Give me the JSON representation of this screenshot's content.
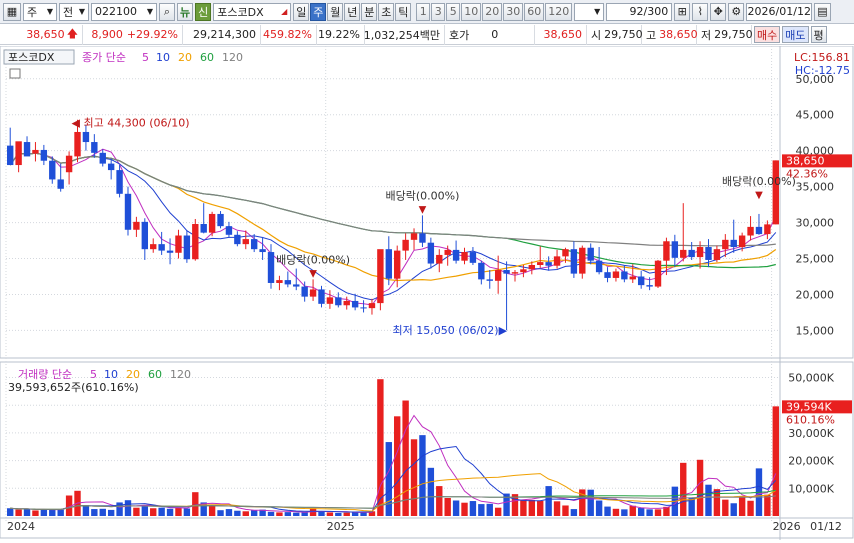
{
  "toolbar": {
    "period_type": "주",
    "scope": "전",
    "code": "022100",
    "news_badge": "뉴",
    "credit_badge": "신",
    "stock_name": "포스코DX",
    "periods": [
      "일",
      "주",
      "월",
      "년",
      "분",
      "초",
      "틱"
    ],
    "active_period": "주",
    "minute_options": [
      "1",
      "3",
      "5",
      "10",
      "20",
      "30",
      "60",
      "120"
    ],
    "bar_count": "92",
    "bar_total": "/300",
    "date": "2026/01/12"
  },
  "quote": {
    "price": "38,650",
    "change": "8,900",
    "change_pct": "+29.92%",
    "volume": "29,214,300",
    "volume_ratio": "459.82%",
    "turnover": "19.22%",
    "amount": "1,032,254백만",
    "hoga_label": "호가",
    "hoga_value": "0",
    "hoga_price": "38,650",
    "open_label": "시",
    "open": "29,750",
    "high_label": "고",
    "high": "38,650",
    "low_label": "저",
    "low": "29,750",
    "buy_label": "매수",
    "sell_label": "매도",
    "eval_label": "평"
  },
  "chart_data": {
    "type": "candlestick",
    "title": "포스코DX",
    "legend": {
      "price_label": "종가 단순",
      "ma_periods": [
        "5",
        "10",
        "20",
        "60",
        "120"
      ],
      "ma_colors": [
        "#c02fc0",
        "#2040d0",
        "#f0a000",
        "#20a040",
        "#808080"
      ],
      "volume_label": "거래량 단순",
      "volume_value": "39,593,652주(610.16%)"
    },
    "corner": {
      "lc": "LC:156.81",
      "hc": "HC:-12.75"
    },
    "price_axis": {
      "ticks": [
        "50,000",
        "45,000",
        "40,000",
        "35,000",
        "30,000",
        "25,000",
        "20,000",
        "15,000"
      ],
      "values": [
        50000,
        45000,
        40000,
        35000,
        30000,
        25000,
        20000,
        15000
      ],
      "ylim": [
        12000,
        54000
      ]
    },
    "volume_axis": {
      "ticks": [
        "50,000K",
        "40,000K",
        "30,000K",
        "20,000K",
        "10,000K"
      ],
      "values": [
        50000,
        40000,
        30000,
        20000,
        10000
      ],
      "ylim": [
        0,
        52000
      ]
    },
    "last_price_tag": {
      "price": "38,650",
      "pct": "42.36%"
    },
    "last_volume_tag": {
      "volume": "39,594K",
      "pct": "610.16%"
    },
    "x_labels": [
      {
        "label": "2024",
        "index": 0
      },
      {
        "label": "2025",
        "index": 38
      },
      {
        "label": "2026",
        "index": 91
      }
    ],
    "x_end_label": "01/12",
    "annotations": [
      {
        "text": "최고 44,300 (06/10)",
        "type": "high",
        "index": 8,
        "price": 44300
      },
      {
        "text": "최저 15,050 (06/02)",
        "type": "low",
        "index": 59,
        "price": 15050
      },
      {
        "text": "배당락(0.00%)",
        "type": "div",
        "index": 36,
        "price": 22100
      },
      {
        "text": "배당락(0.00%)",
        "type": "div",
        "index": 49,
        "price": 31000
      },
      {
        "text": "배당락(0.00%)",
        "type": "div",
        "index": 89,
        "price": 33000
      }
    ],
    "candles": [
      [
        40700,
        43200,
        38500,
        38000
      ],
      [
        38000,
        39800,
        37000,
        41300
      ],
      [
        41200,
        42000,
        39800,
        39200
      ],
      [
        39600,
        41200,
        38500,
        40100
      ],
      [
        40100,
        40800,
        38000,
        38600
      ],
      [
        38600,
        39200,
        35400,
        36000
      ],
      [
        36000,
        38200,
        34300,
        34700
      ],
      [
        37000,
        39900,
        35300,
        39300
      ],
      [
        39200,
        44300,
        38400,
        42600
      ],
      [
        42600,
        43600,
        40000,
        41200
      ],
      [
        41200,
        42300,
        39000,
        39700
      ],
      [
        39700,
        40200,
        37800,
        38200
      ],
      [
        38200,
        38900,
        36000,
        37300
      ],
      [
        37300,
        38000,
        33500,
        34000
      ],
      [
        34000,
        35000,
        28200,
        29000
      ],
      [
        29000,
        30800,
        28000,
        30100
      ],
      [
        30100,
        30600,
        24800,
        26300
      ],
      [
        26300,
        27800,
        25800,
        27000
      ],
      [
        27000,
        28700,
        25500,
        26100
      ],
      [
        26100,
        27800,
        24200,
        25800
      ],
      [
        25800,
        29000,
        25000,
        28200
      ],
      [
        28200,
        28900,
        24400,
        24900
      ],
      [
        24900,
        30500,
        24700,
        29800
      ],
      [
        29800,
        32700,
        28500,
        28600
      ],
      [
        28600,
        31500,
        28100,
        31200
      ],
      [
        31200,
        31600,
        29200,
        29500
      ],
      [
        29500,
        30100,
        27900,
        28300
      ],
      [
        28300,
        28800,
        26700,
        27000
      ],
      [
        27000,
        28900,
        26300,
        27700
      ],
      [
        27700,
        28400,
        25900,
        26300
      ],
      [
        26300,
        28000,
        24800,
        25900
      ],
      [
        25900,
        27000,
        20800,
        21600
      ],
      [
        21600,
        22600,
        20600,
        22000
      ],
      [
        22000,
        23200,
        21000,
        21400
      ],
      [
        21400,
        23600,
        20600,
        21100
      ],
      [
        21100,
        21800,
        19000,
        19700
      ],
      [
        19700,
        22100,
        19100,
        20700
      ],
      [
        20700,
        21200,
        18200,
        18700
      ],
      [
        18700,
        20600,
        18000,
        19600
      ],
      [
        19600,
        20300,
        18200,
        18500
      ],
      [
        18500,
        19700,
        17900,
        19100
      ],
      [
        19100,
        20100,
        17800,
        18200
      ],
      [
        18200,
        19200,
        17500,
        18100
      ],
      [
        18100,
        19400,
        17200,
        18800
      ],
      [
        18800,
        23800,
        17800,
        26300
      ],
      [
        26300,
        28100,
        21300,
        22200
      ],
      [
        22200,
        26800,
        21000,
        26100
      ],
      [
        26100,
        28500,
        24800,
        27600
      ],
      [
        27600,
        29200,
        26200,
        28500
      ],
      [
        28500,
        31000,
        26600,
        27200
      ],
      [
        27200,
        27900,
        23600,
        24300
      ],
      [
        24300,
        26300,
        23100,
        25500
      ],
      [
        25500,
        26800,
        24000,
        26200
      ],
      [
        26200,
        27500,
        24300,
        24700
      ],
      [
        24700,
        26500,
        24200,
        25900
      ],
      [
        25900,
        26600,
        24100,
        24400
      ],
      [
        24400,
        24700,
        21400,
        22100
      ],
      [
        22100,
        23400,
        20800,
        21900
      ],
      [
        21900,
        25400,
        20100,
        23400
      ],
      [
        23400,
        24600,
        15050,
        22900
      ],
      [
        22900,
        23400,
        21800,
        23100
      ],
      [
        23100,
        24100,
        22400,
        23500
      ],
      [
        23500,
        24600,
        22800,
        24100
      ],
      [
        24100,
        26700,
        23700,
        24500
      ],
      [
        24500,
        25300,
        23300,
        24000
      ],
      [
        24000,
        26200,
        23600,
        25300
      ],
      [
        25300,
        26500,
        24400,
        26300
      ],
      [
        26300,
        27400,
        22300,
        22900
      ],
      [
        22900,
        26800,
        22200,
        26500
      ],
      [
        26500,
        27100,
        24200,
        24700
      ],
      [
        24700,
        26600,
        22800,
        23100
      ],
      [
        23100,
        23800,
        21700,
        22300
      ],
      [
        22300,
        23600,
        21800,
        23200
      ],
      [
        23200,
        24100,
        21700,
        22100
      ],
      [
        22100,
        24200,
        21600,
        22500
      ],
      [
        22500,
        23300,
        20800,
        21300
      ],
      [
        21300,
        22400,
        20600,
        21100
      ],
      [
        21100,
        24800,
        20900,
        24700
      ],
      [
        24700,
        27900,
        22700,
        27400
      ],
      [
        27400,
        28300,
        23800,
        25100
      ],
      [
        25100,
        32700,
        24600,
        26200
      ],
      [
        26200,
        27300,
        24800,
        25200
      ],
      [
        25200,
        27400,
        23600,
        26600
      ],
      [
        26600,
        27700,
        23800,
        24800
      ],
      [
        24800,
        26800,
        24500,
        26300
      ],
      [
        26300,
        28400,
        25200,
        27600
      ],
      [
        27600,
        30400,
        25800,
        26600
      ],
      [
        26600,
        28600,
        26000,
        28200
      ],
      [
        28200,
        30900,
        27500,
        29400
      ],
      [
        29400,
        31200,
        28300,
        28400
      ],
      [
        28400,
        30300,
        27700,
        29750
      ],
      [
        29750,
        38650,
        29750,
        38650
      ]
    ],
    "volume_k": [
      2800,
      2300,
      2600,
      2000,
      2200,
      2400,
      2300,
      7400,
      9100,
      3900,
      2500,
      2600,
      2200,
      4900,
      5700,
      3000,
      3500,
      2800,
      3000,
      2600,
      3100,
      2700,
      8600,
      4900,
      3800,
      2100,
      2500,
      1900,
      1700,
      2100,
      2300,
      1500,
      1300,
      1400,
      1200,
      1300,
      2800,
      1500,
      1300,
      1100,
      1200,
      1400,
      1500,
      1700,
      49400,
      26700,
      36000,
      41700,
      27700,
      29200,
      17400,
      10800,
      6500,
      5600,
      4800,
      5400,
      4300,
      4400,
      3000,
      8100,
      7900,
      5900,
      5800,
      5500,
      10800,
      5300,
      3800,
      2500,
      9600,
      9500,
      5600,
      3400,
      2600,
      2400,
      3700,
      2900,
      2400,
      2400,
      3300,
      10600,
      19200,
      6700,
      20300,
      11300,
      9700,
      5900,
      4600,
      7000,
      5500,
      17200,
      7700,
      39594
    ]
  },
  "colors": {
    "up": "#e8201f",
    "down": "#1f4fd8",
    "grid": "#d4d8de",
    "axis_text": "#333333",
    "tag_red": "#e8201f"
  }
}
